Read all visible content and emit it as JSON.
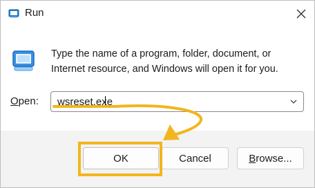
{
  "window": {
    "title": "Run",
    "description": "Type the name of a program, folder, document, or Internet resource, and Windows will open it for you."
  },
  "open": {
    "label_prefix": "",
    "label_underlined": "O",
    "label_rest": "pen:",
    "value": "wsreset.exe"
  },
  "buttons": {
    "ok": "OK",
    "cancel": "Cancel",
    "browse_underlined": "B",
    "browse_rest": "rowse..."
  },
  "icons": {
    "app": "run-icon",
    "close": "close-icon",
    "dropdown": "chevron-down-icon"
  },
  "colors": {
    "annotation": "#f2b51c",
    "accent": "#0f6cbd"
  }
}
